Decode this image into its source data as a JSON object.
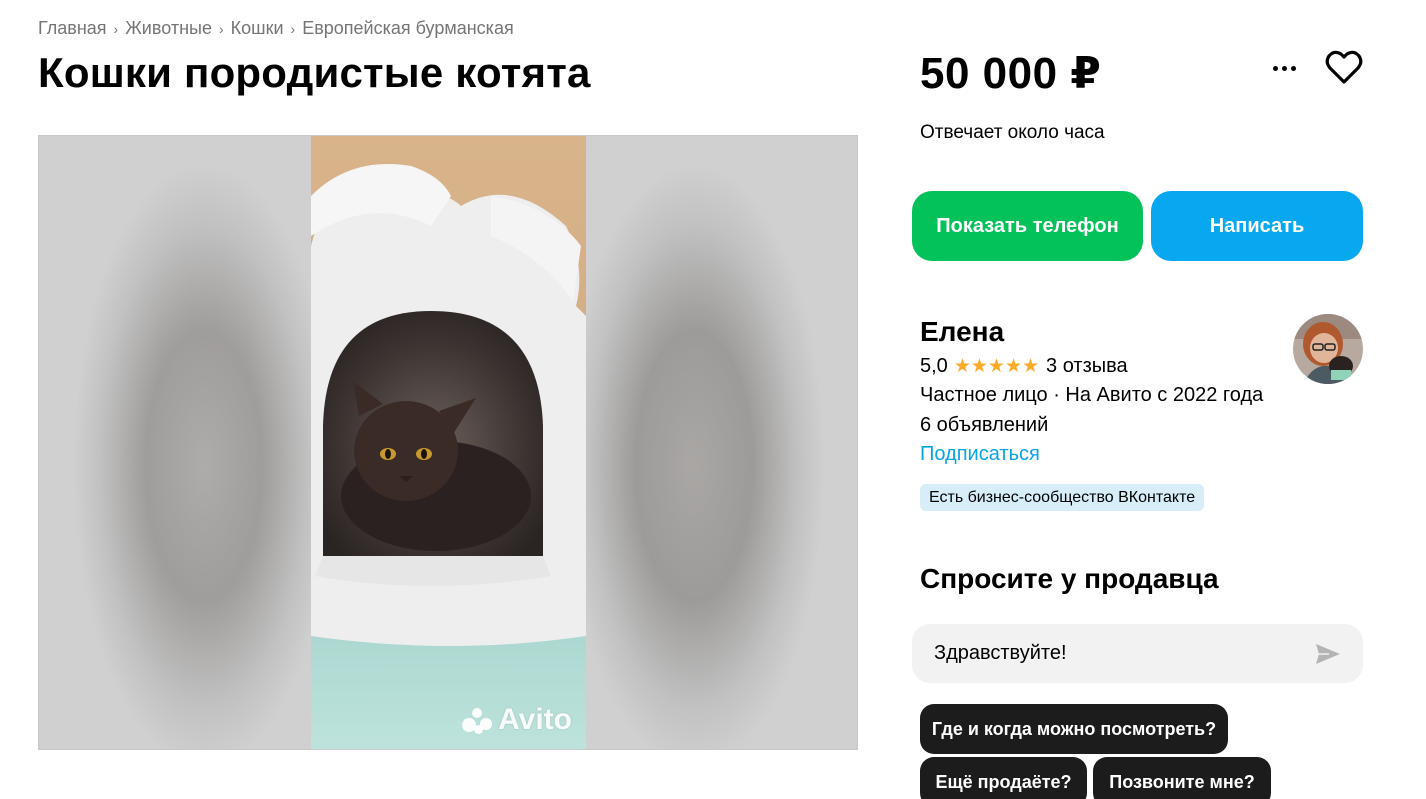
{
  "breadcrumbs": [
    "Главная",
    "Животные",
    "Кошки",
    "Европейская бурманская"
  ],
  "listing": {
    "title": "Кошки породистые котята",
    "price": "50 000 ₽",
    "reply_time": "Отвечает около часа"
  },
  "photo": {
    "watermark": "Avito"
  },
  "actions": {
    "show_phone": "Показать телефон",
    "write": "Написать",
    "more_icon": "more-dots-icon",
    "favorite_icon": "heart-icon"
  },
  "seller": {
    "name": "Елена",
    "rating": "5,0",
    "stars": 5,
    "reviews": "3 отзыва",
    "type": "Частное лицо · На Авито с 2022 года",
    "ads": "6 объявлений",
    "subscribe": "Подписаться",
    "badge": "Есть бизнес-сообщество ВКонтакте"
  },
  "ask": {
    "title": "Спросите у продавца",
    "message": "Здравствуйте!",
    "quick_questions": [
      "Где и когда можно посмотреть?",
      "Ещё продаёте?",
      "Позвоните мне?"
    ]
  },
  "colors": {
    "green": "#04c25a",
    "blue": "#07a8f0",
    "link": "#0aa3e6",
    "star": "#ffa928",
    "badge_bg": "#d7eef9"
  }
}
